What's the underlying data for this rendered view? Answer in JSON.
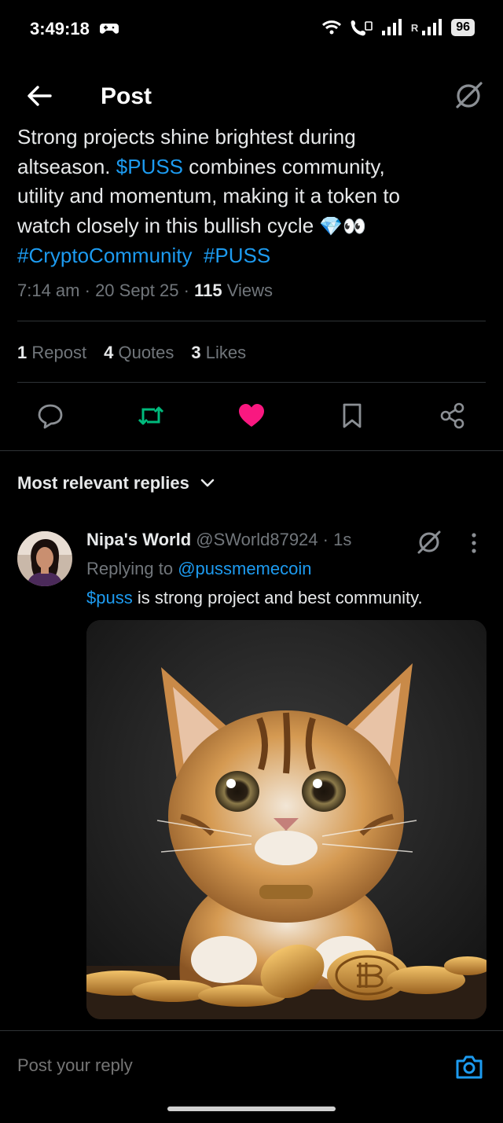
{
  "status_bar": {
    "time": "3:49:18",
    "roaming": "R",
    "battery": "96"
  },
  "header": {
    "title": "Post"
  },
  "post": {
    "line1": "Strong projects shine brightest during",
    "line2_a": "altseason. ",
    "ticker": "$PUSS",
    "line2_b": " combines community,",
    "line3": "utility and momentum, making it a token to",
    "line4": "watch closely in this bullish cycle ",
    "emoji": "💎👀",
    "hashtag1": "#CryptoCommunity",
    "hashtag2": "#PUSS",
    "time": "7:14 am",
    "date": "20 Sept 25",
    "views_count": "115",
    "views_label": "Views",
    "meta_sep": " · "
  },
  "stats": {
    "reposts_count": "1",
    "reposts_label": "Repost",
    "quotes_count": "4",
    "quotes_label": "Quotes",
    "likes_count": "3",
    "likes_label": "Likes"
  },
  "actions": {
    "reply_icon": "comment-icon",
    "repost_icon": "repost-icon",
    "like_icon": "heart-icon",
    "bookmark_icon": "bookmark-icon",
    "share_icon": "share-icon",
    "repost_color": "#00ba7c",
    "like_color": "#f91880"
  },
  "replies": {
    "sort_label": "Most relevant replies",
    "items": [
      {
        "name": "Nipa's World",
        "handle": "@SWorld87924",
        "time": "1s",
        "replying_prefix": "Replying to ",
        "replying_to": "@pussmemecoin",
        "ticker": "$puss",
        "text": " is strong project and best community."
      }
    ]
  },
  "composer": {
    "placeholder": "Post your reply"
  },
  "colors": {
    "background": "#000000",
    "text": "#e7e9ea",
    "secondary": "#71767b",
    "link": "#1d9bf0",
    "divider": "#2f3336"
  }
}
